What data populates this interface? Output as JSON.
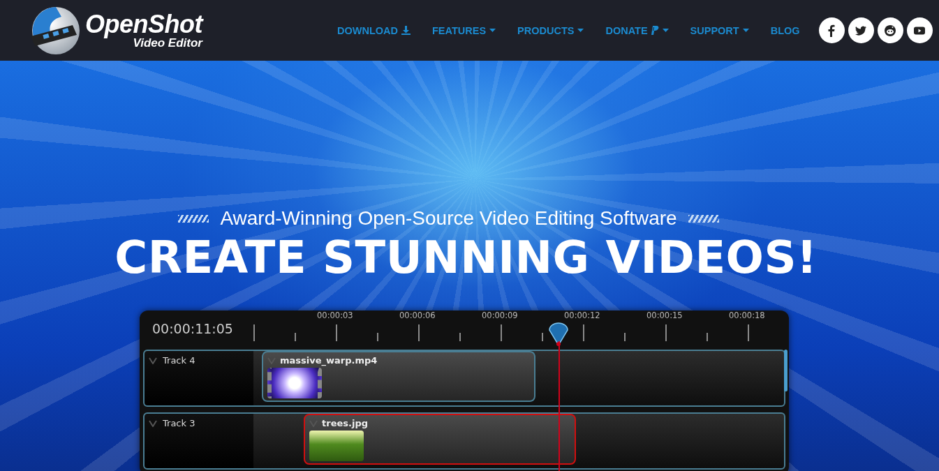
{
  "logo": {
    "title": "OpenShot",
    "subtitle": "Video Editor"
  },
  "nav": [
    {
      "label": "DOWNLOAD",
      "kind": "download"
    },
    {
      "label": "FEATURES",
      "kind": "menu"
    },
    {
      "label": "PRODUCTS",
      "kind": "menu"
    },
    {
      "label": "DONATE",
      "kind": "donate"
    },
    {
      "label": "SUPPORT",
      "kind": "menu"
    },
    {
      "label": "BLOG",
      "kind": "link"
    }
  ],
  "social": [
    {
      "kind": "facebook"
    },
    {
      "kind": "twitter"
    },
    {
      "kind": "reddit"
    },
    {
      "kind": "youtube"
    }
  ],
  "hero": {
    "tagline": "Award-Winning Open-Source Video Editing Software",
    "headline": "CREATE STUNNING VIDEOS!"
  },
  "timeline": {
    "current_time": "00:00:11:05",
    "ruler_labels": [
      "00:00:03",
      "00:00:06",
      "00:00:09",
      "00:00:12",
      "00:00:15",
      "00:00:18"
    ],
    "tracks": [
      {
        "name": "Track 4",
        "clips": [
          {
            "name": "massive_warp.mp4",
            "kind": "video",
            "selected": false
          }
        ]
      },
      {
        "name": "Track 3",
        "clips": [
          {
            "name": "trees.jpg",
            "kind": "image",
            "selected": true
          }
        ]
      }
    ]
  }
}
